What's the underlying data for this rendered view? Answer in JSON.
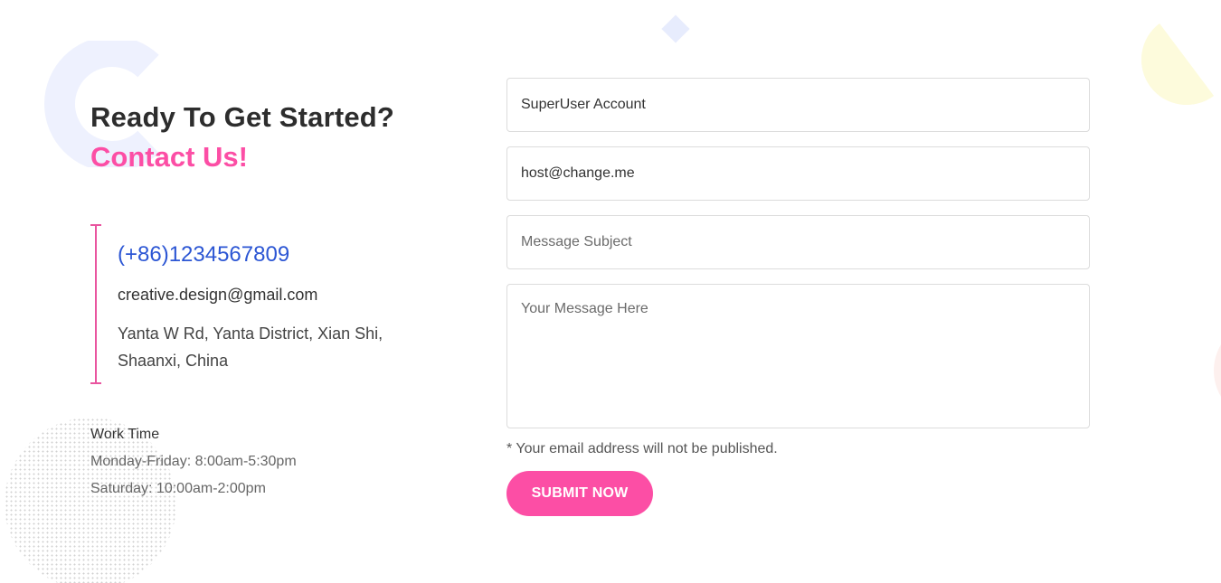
{
  "heading": {
    "line1": "Ready To Get Started?",
    "line2": "Contact Us!"
  },
  "contact": {
    "phone": "(+86)1234567809",
    "email": "creative.design@gmail.com",
    "address": "Yanta W Rd, Yanta District, Xian Shi, Shaanxi, China"
  },
  "work_time": {
    "title": "Work Time",
    "lines": [
      "Monday-Friday: 8:00am-5:30pm",
      "Saturday: 10:00am-2:00pm"
    ]
  },
  "form": {
    "name_value": "SuperUser Account",
    "email_value": "host@change.me",
    "subject_placeholder": "Message Subject",
    "message_placeholder": "Your Message Here",
    "note": "* Your email address will not be published.",
    "submit_label": "SUBMIT NOW"
  },
  "colors": {
    "accent_pink": "#fc4ea5",
    "phone_blue": "#2c56d4",
    "heading_dark": "#2d2d2d"
  }
}
